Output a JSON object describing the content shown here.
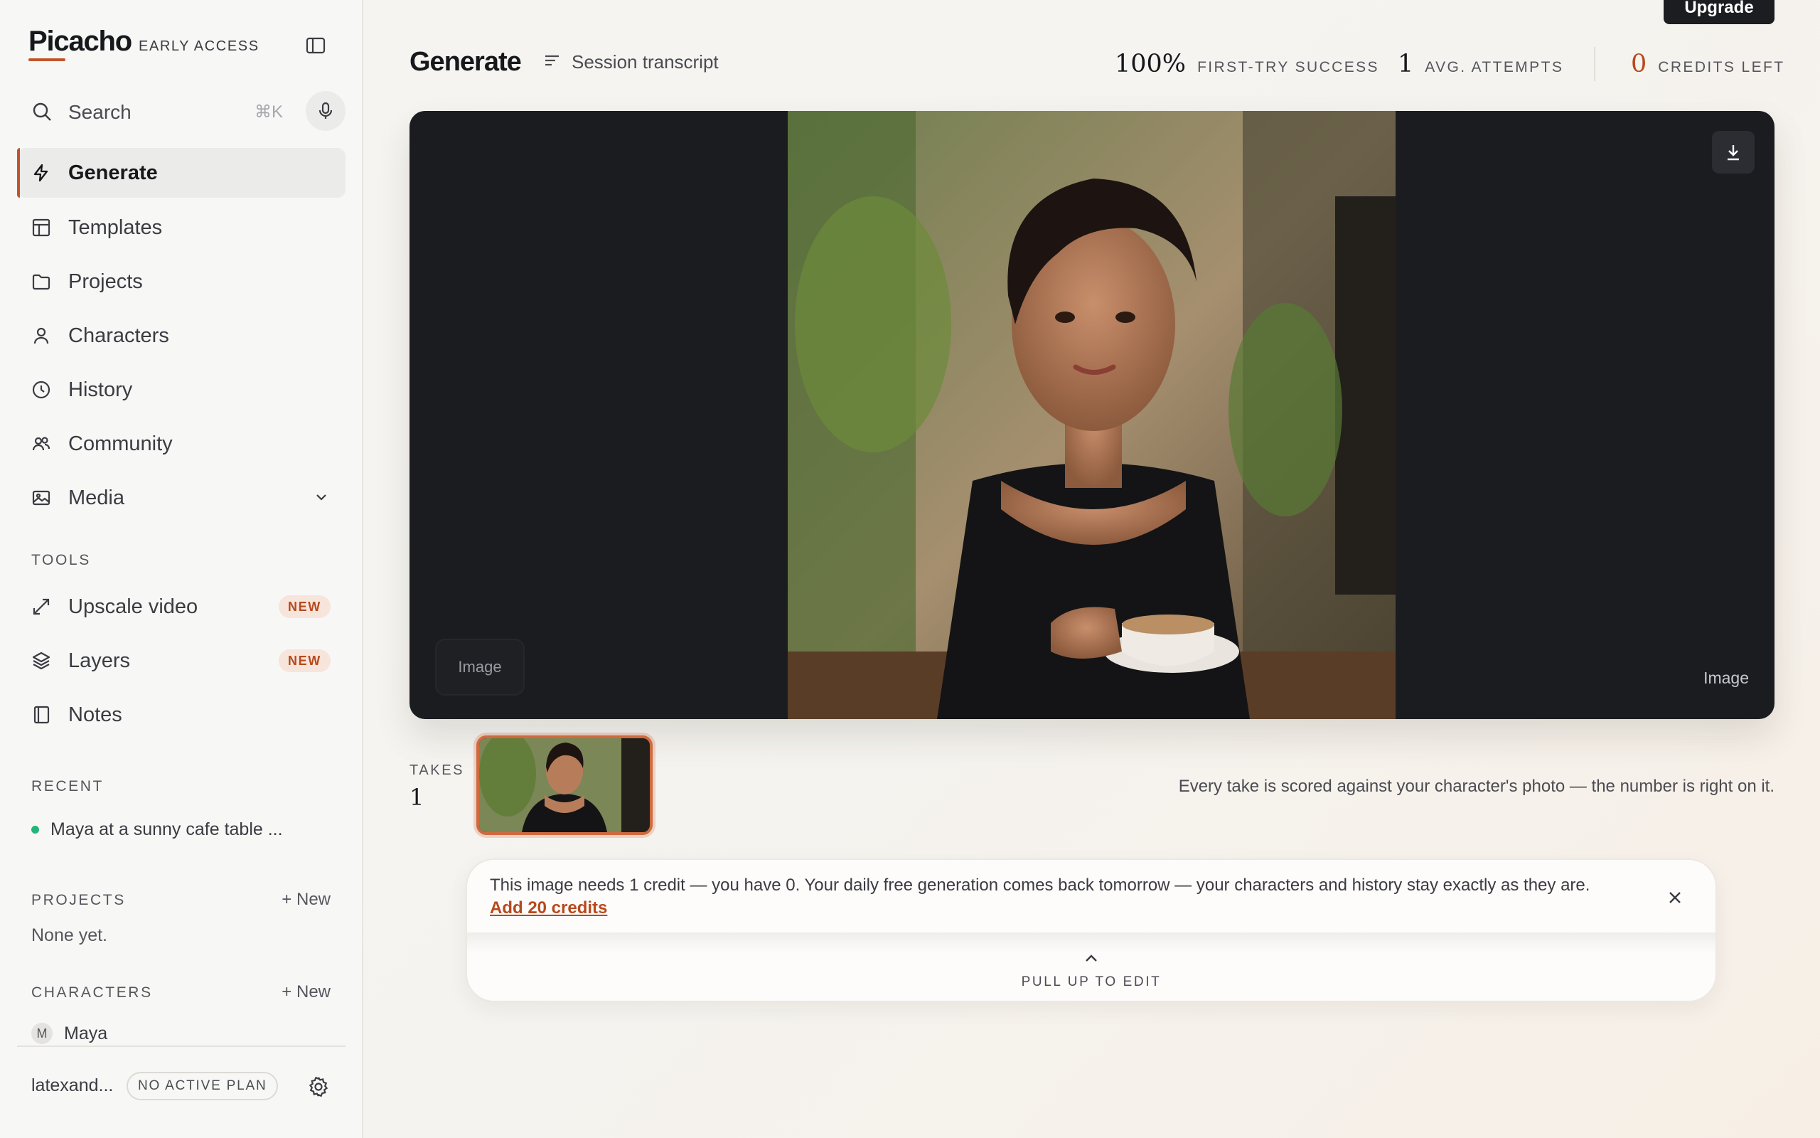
{
  "brand": {
    "name": "Picacho",
    "sub": "EARLY ACCESS"
  },
  "search": {
    "label": "Search",
    "shortcut": "⌘K"
  },
  "nav": [
    {
      "label": "Generate",
      "icon": "bolt-icon",
      "active": true
    },
    {
      "label": "Templates",
      "icon": "layout-icon"
    },
    {
      "label": "Projects",
      "icon": "folder-icon"
    },
    {
      "label": "Characters",
      "icon": "person-icon"
    },
    {
      "label": "History",
      "icon": "clock-icon"
    },
    {
      "label": "Community",
      "icon": "users-icon"
    },
    {
      "label": "Media",
      "icon": "image-icon"
    }
  ],
  "tools": {
    "heading": "TOOLS",
    "items": [
      {
        "label": "Upscale video",
        "badge": "NEW",
        "icon": "expand-icon"
      },
      {
        "label": "Layers",
        "badge": "NEW",
        "icon": "layers-icon"
      },
      {
        "label": "Notes",
        "icon": "notebook-icon"
      }
    ]
  },
  "recent": {
    "heading": "RECENT",
    "items": [
      "Maya at a sunny cafe table ..."
    ]
  },
  "projects": {
    "heading": "PROJECTS",
    "new_label": "+ New",
    "empty": "None yet."
  },
  "characters": {
    "heading": "CHARACTERS",
    "new_label": "+ New",
    "items": [
      {
        "initial": "M",
        "name": "Maya"
      }
    ]
  },
  "account": {
    "name": "latexand...",
    "plan": "NO ACTIVE PLAN"
  },
  "header": {
    "upgrade": "Upgrade",
    "title": "Generate",
    "transcript": "Session transcript",
    "stats": [
      {
        "value": "100%",
        "label": "FIRST-TRY SUCCESS"
      },
      {
        "value": "1",
        "label": "AVG. ATTEMPTS"
      },
      {
        "value": "0",
        "label": "CREDITS LEFT"
      }
    ]
  },
  "stage": {
    "chip_label": "Image",
    "corner_label": "Image"
  },
  "takes": {
    "label": "TAKES",
    "count": "1",
    "note": "Every take is scored against your character's photo — the number is right on it."
  },
  "credit_notice": {
    "message": "This image needs 1 credit — you have 0. Your daily free generation comes back tomorrow — your characters and history stay exactly as they are.",
    "link": "Add 20 credits",
    "pull_label": "PULL UP TO EDIT"
  },
  "colors": {
    "accent": "#c0552a",
    "new_badge_bg": "#f7e4da",
    "status_green": "#23b57a",
    "stage_bg": "#1b1c20"
  }
}
